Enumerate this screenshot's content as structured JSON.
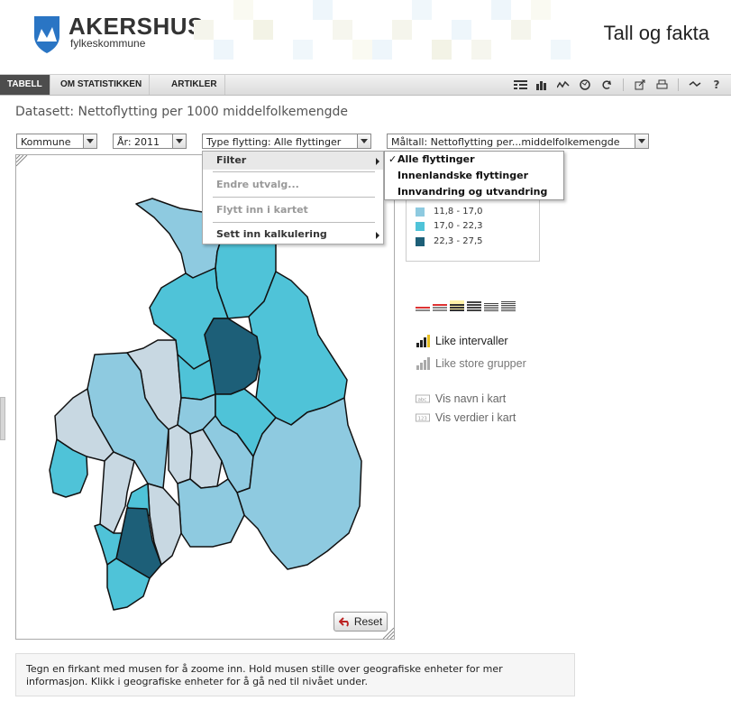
{
  "header": {
    "org_name": "AKERSHUS",
    "org_sub": "fylkeskommune",
    "app_title": "Tall og fakta"
  },
  "tabs": [
    {
      "label": "TABELL",
      "active": true
    },
    {
      "label": "OM STATISTIKKEN",
      "active": false
    },
    {
      "label": "ARTIKLER",
      "active": false
    }
  ],
  "toolbar_icons": [
    "table-icon",
    "bar-chart-icon",
    "line-chart-icon",
    "map-icon",
    "refresh-icon",
    "export-icon",
    "print-icon",
    "settings-icon",
    "help-icon"
  ],
  "dataset_title": "Datasett: Nettoflytting per 1000 middelfolkemengde",
  "selects": {
    "region": "Kommune",
    "year": "År: 2011",
    "move_type": "Type flytting: Alle flyttinger",
    "measure": "Måltall: Nettoflytting per...middelfolkemengde"
  },
  "context_menu": {
    "filter": "Filter",
    "edit_selection": "Endre utvalg...",
    "move_into_map": "Flytt inn i kartet",
    "insert_calc": "Sett inn kalkulering"
  },
  "filter_submenu": [
    {
      "label": "Alle flyttinger",
      "checked": true
    },
    {
      "label": "Innenlandske flyttinger",
      "checked": false
    },
    {
      "label": "Innvandring og utvandring",
      "checked": false
    }
  ],
  "legend": [
    {
      "label": "11,8 - 17,0",
      "color": "#8ecae0"
    },
    {
      "label": "17,0 - 22,3",
      "color": "#4fc3d8"
    },
    {
      "label": "22,3 - 27,5",
      "color": "#1d5f78"
    }
  ],
  "options": {
    "equal_intervals": "Like intervaller",
    "equal_groups": "Like store grupper",
    "show_names": "Vis navn i kart",
    "show_values": "Vis verdier i kart"
  },
  "reset_label": "Reset",
  "info_text": "Tegn en firkant med musen for å zoome inn. Hold musen stille over geografiske enheter for mer informasjon. Klikk i geografiske enheter for å gå ned til nivået under.",
  "colors": {
    "light": "#c8d8e2",
    "mid": "#8ecae0",
    "bright": "#4fc3d8",
    "dark": "#1d5f78",
    "tab_active": "#4d4d4d"
  }
}
